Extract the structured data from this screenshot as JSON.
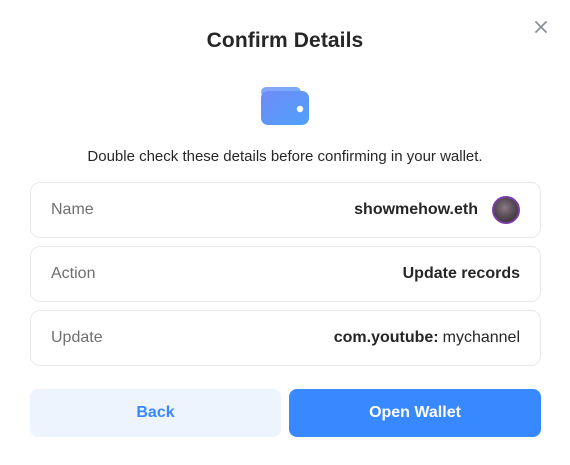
{
  "dialog": {
    "title": "Confirm Details",
    "subtitle": "Double check these details before confirming in your wallet.",
    "close_icon": "close-icon",
    "wallet_icon": "wallet-icon"
  },
  "details": {
    "name": {
      "label": "Name",
      "value": "showmehow.eth",
      "avatar": "avatar"
    },
    "action": {
      "label": "Action",
      "value": "Update records"
    },
    "update": {
      "label": "Update",
      "key": "com.youtube:",
      "value": "mychannel"
    }
  },
  "buttons": {
    "back_label": "Back",
    "open_wallet_label": "Open Wallet"
  },
  "colors": {
    "accent": "#3888ff",
    "back_bg": "#eef4fd",
    "text": "#262626",
    "label": "#6f6f6f",
    "border": "#e8e8e8"
  }
}
